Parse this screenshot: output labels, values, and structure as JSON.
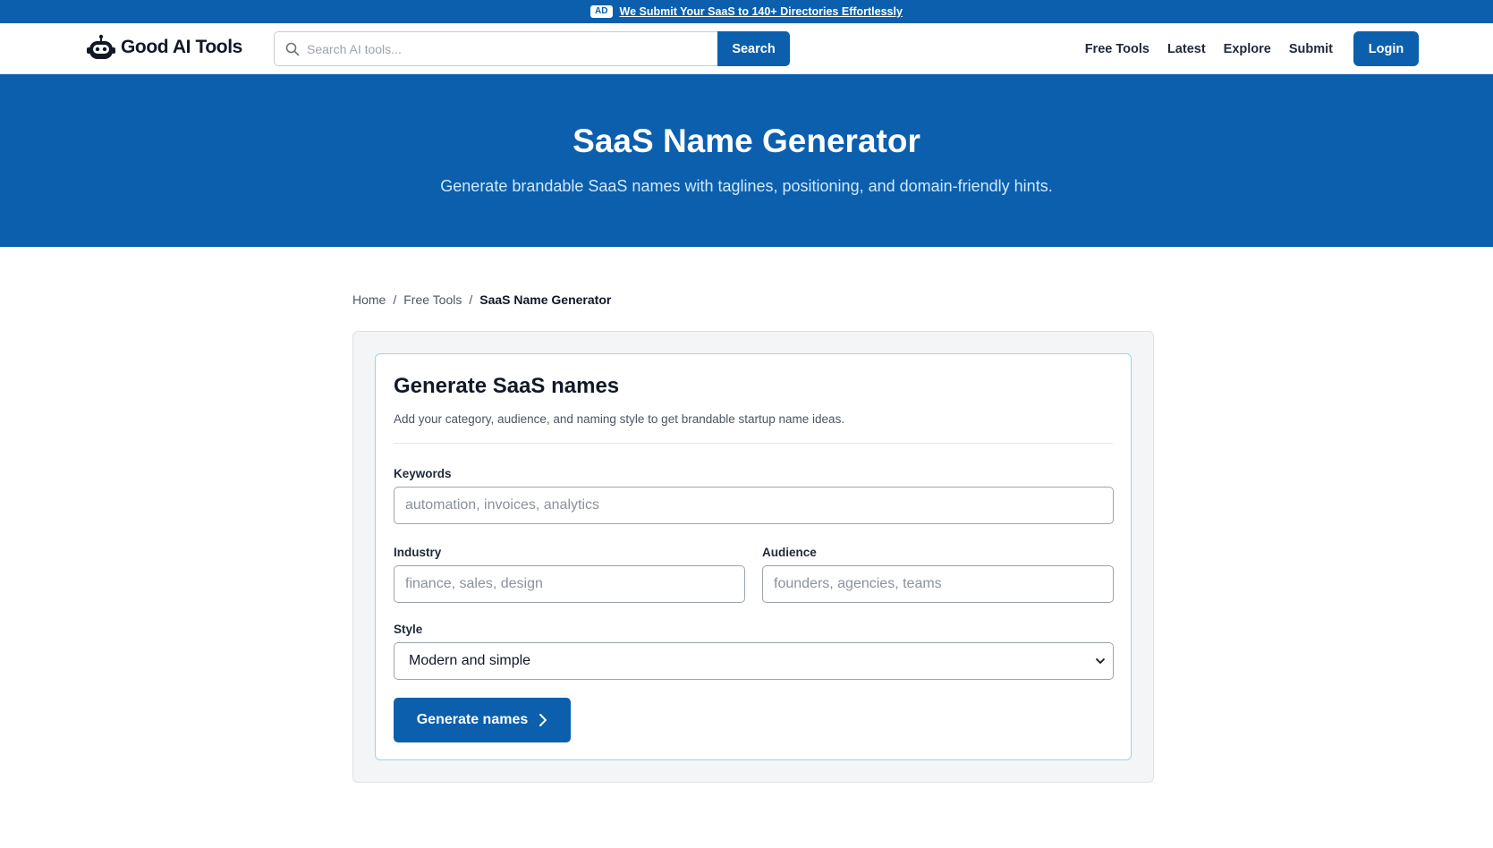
{
  "ad": {
    "badge": "AD",
    "text": "We Submit Your SaaS to 140+ Directories Effortlessly"
  },
  "header": {
    "logo_text": "Good AI Tools",
    "search_placeholder": "Search AI tools...",
    "search_button": "Search",
    "nav": [
      "Free Tools",
      "Latest",
      "Explore",
      "Submit"
    ],
    "login": "Login"
  },
  "hero": {
    "title": "SaaS Name Generator",
    "subtitle": "Generate brandable SaaS names with taglines, positioning, and domain-friendly hints."
  },
  "breadcrumb": {
    "items": [
      "Home",
      "Free Tools",
      "SaaS Name Generator"
    ],
    "separator": "/"
  },
  "form": {
    "title": "Generate SaaS names",
    "description": "Add your category, audience, and naming style to get brandable startup name ideas.",
    "keywords_label": "Keywords",
    "keywords_placeholder": "automation, invoices, analytics",
    "industry_label": "Industry",
    "industry_placeholder": "finance, sales, design",
    "audience_label": "Audience",
    "audience_placeholder": "founders, agencies, teams",
    "style_label": "Style",
    "style_value": "Modern and simple",
    "submit_label": "Generate names"
  },
  "colors": {
    "brand": "#0b5fad",
    "hero_subtitle": "#cfe9ff",
    "card_border": "#9fd3e8"
  }
}
